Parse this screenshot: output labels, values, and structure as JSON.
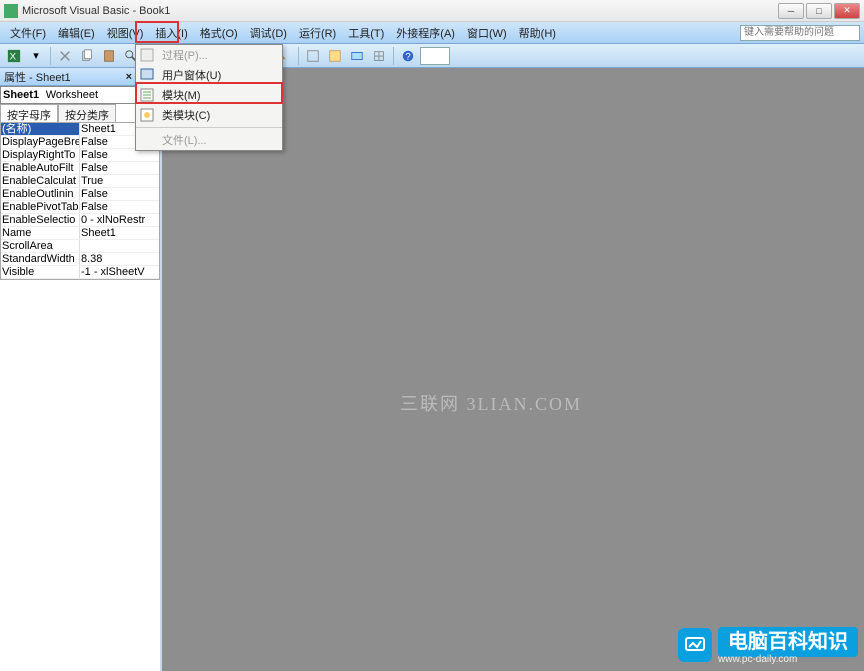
{
  "titlebar": {
    "title": "Microsoft Visual Basic - Book1"
  },
  "menubar": {
    "items": [
      {
        "label": "文件(F)",
        "key": "F"
      },
      {
        "label": "编辑(E)",
        "key": "E"
      },
      {
        "label": "视图(V)",
        "key": "V"
      },
      {
        "label": "插入(I)",
        "key": "I"
      },
      {
        "label": "格式(O)",
        "key": "O"
      },
      {
        "label": "调试(D)",
        "key": "D"
      },
      {
        "label": "运行(R)",
        "key": "R"
      },
      {
        "label": "工具(T)",
        "key": "T"
      },
      {
        "label": "外接程序(A)",
        "key": "A"
      },
      {
        "label": "窗口(W)",
        "key": "W"
      },
      {
        "label": "帮助(H)",
        "key": "H"
      }
    ],
    "help_placeholder": "键入需要帮助的问题"
  },
  "dropdown": {
    "items": [
      {
        "label": "过程(P)...",
        "icon": "proc-icon",
        "disabled": true
      },
      {
        "label": "用户窗体(U)",
        "icon": "form-icon",
        "disabled": false
      },
      {
        "label": "模块(M)",
        "icon": "module-icon",
        "disabled": false
      },
      {
        "label": "类模块(C)",
        "icon": "class-icon",
        "disabled": false
      },
      {
        "label": "文件(L)...",
        "icon": "",
        "disabled": true
      }
    ]
  },
  "properties": {
    "panel_title": "属性 - Sheet1",
    "object": {
      "name": "Sheet1",
      "type": "Worksheet"
    },
    "tabs": {
      "alpha": "按字母序",
      "cat": "按分类序"
    },
    "rows": [
      {
        "name": "(名称)",
        "value": "Sheet1",
        "sel": true
      },
      {
        "name": "DisplayPageBre",
        "value": "False"
      },
      {
        "name": "DisplayRightTo",
        "value": "False"
      },
      {
        "name": "EnableAutoFilt",
        "value": "False"
      },
      {
        "name": "EnableCalculat",
        "value": "True"
      },
      {
        "name": "EnableOutlinin",
        "value": "False"
      },
      {
        "name": "EnablePivotTab",
        "value": "False"
      },
      {
        "name": "EnableSelectio",
        "value": "0 - xlNoRestr"
      },
      {
        "name": "Name",
        "value": "Sheet1"
      },
      {
        "name": "ScrollArea",
        "value": ""
      },
      {
        "name": "StandardWidth",
        "value": "8.38"
      },
      {
        "name": "Visible",
        "value": "-1 - xlSheetV"
      }
    ]
  },
  "watermark": {
    "center": "三联网 3LIAN.COM",
    "brand_cn": "电脑百科知识",
    "brand_url": "www.pc-daily.com"
  }
}
